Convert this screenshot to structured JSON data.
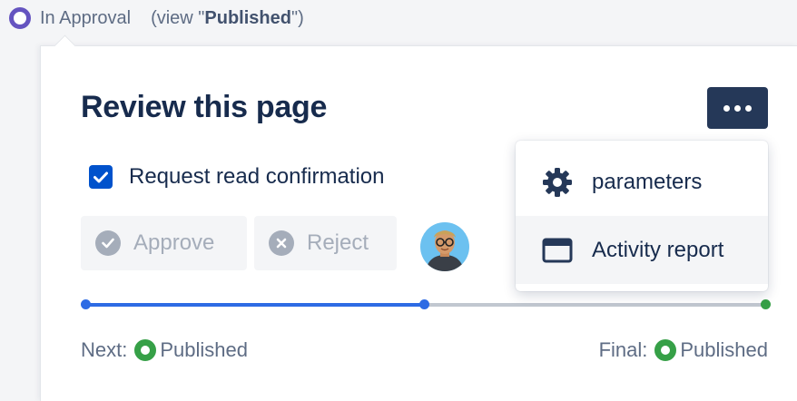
{
  "status": {
    "state": "In Approval",
    "view_prefix": "(view \"",
    "view_value": "Published",
    "view_suffix": "\")",
    "icon": "status-ring-icon",
    "color": "#6554c0"
  },
  "card": {
    "title": "Review this page",
    "more_icon": "more-horizontal-icon",
    "checkbox": {
      "label": "Request read confirmation",
      "checked": true
    },
    "actions": [
      {
        "label": "Approve",
        "icon": "check-circle-icon",
        "enabled": false
      },
      {
        "label": "Reject",
        "icon": "cross-circle-icon",
        "enabled": false
      }
    ],
    "avatar": "reviewer-avatar",
    "workflow": {
      "next_label": "Next:",
      "next_value": "Published",
      "final_label": "Final:",
      "final_value": "Published"
    }
  },
  "menu": {
    "items": [
      {
        "label": "parameters",
        "icon": "gear-icon"
      },
      {
        "label": "Activity report",
        "icon": "window-icon"
      }
    ]
  },
  "colors": {
    "accent": "#0052cc",
    "dark_button": "#253858",
    "progress": "#2d6be4",
    "success": "#36a047"
  }
}
